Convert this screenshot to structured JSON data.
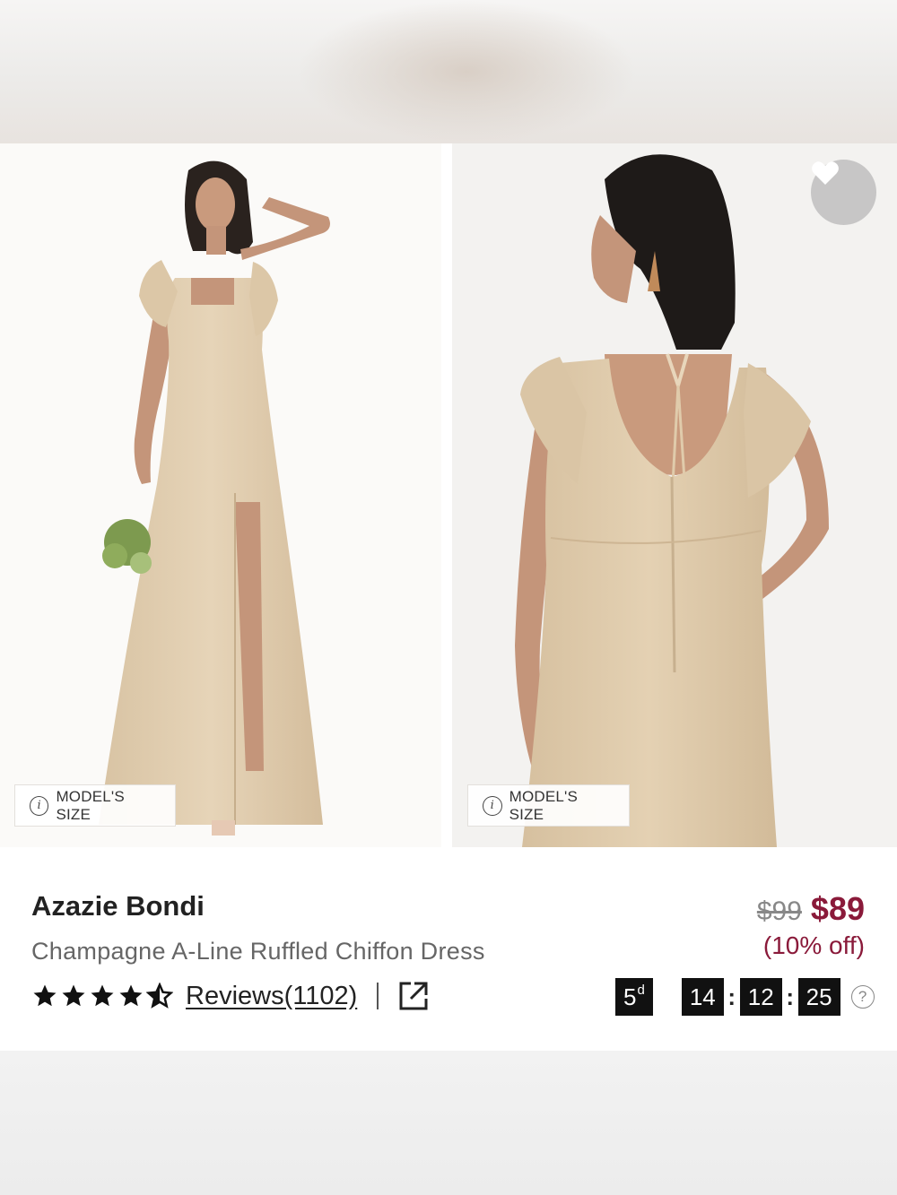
{
  "product": {
    "brand": "Azazie Bondi",
    "description": "Champagne A-Line Ruffled Chiffon Dress",
    "rating": 4.5,
    "reviews_label": "Reviews(1102)",
    "old_price": "$99",
    "new_price": "$89",
    "discount": "(10% off)"
  },
  "gallery": {
    "badge_label": "MODEL'S SIZE",
    "info_glyph": "i"
  },
  "countdown": {
    "days": "5",
    "days_unit": "d",
    "hours": "14",
    "minutes": "12",
    "seconds": "25",
    "help_glyph": "?"
  },
  "colors": {
    "price_accent": "#8a1a3a",
    "dress": "#e2cfb1",
    "timer_bg": "#111111"
  },
  "icons": [
    "info-icon",
    "heart-icon",
    "star-icon",
    "external-link-icon",
    "help-icon"
  ]
}
